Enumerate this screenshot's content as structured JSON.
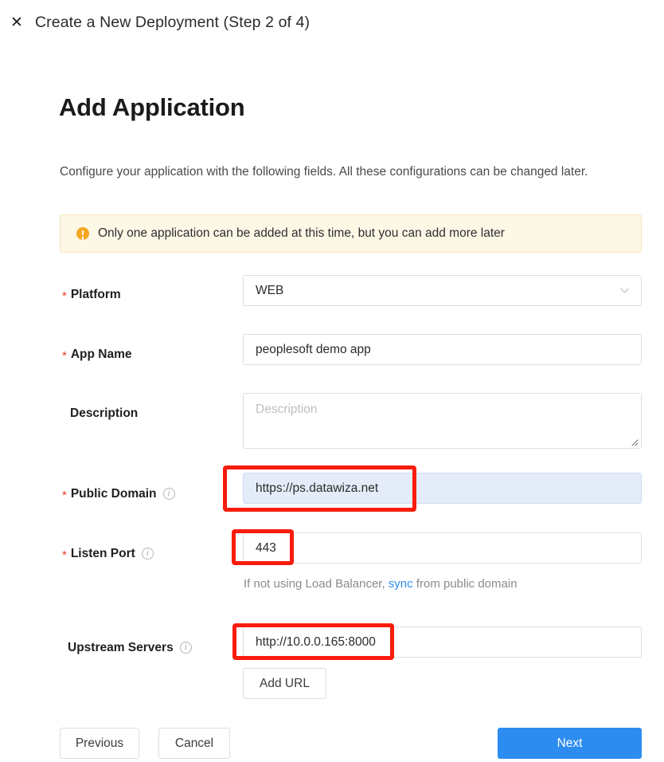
{
  "window": {
    "close_icon": "close-x-icon",
    "title": "Create a New Deployment (Step 2 of 4)"
  },
  "page": {
    "title": "Add Application",
    "subtitle": "Configure your application with the following fields. All these configurations can be changed later."
  },
  "alert": {
    "icon": "warning-circle-icon",
    "text": "Only one application can be added at this time, but you can add more later",
    "background_color": "#fdf7e6",
    "border_color": "#f5e6b8",
    "icon_color": "#f5a623"
  },
  "form": {
    "required_marker": "*",
    "info_icon_glyph": "i",
    "fields": [
      {
        "label": "Platform",
        "required": true,
        "has_info": false,
        "type": "select",
        "value": "WEB",
        "caret_icon": "chevron-down-icon"
      },
      {
        "label": "App Name",
        "required": true,
        "has_info": false,
        "type": "text",
        "value": "peoplesoft demo app"
      },
      {
        "label": "Description",
        "required": false,
        "has_info": false,
        "type": "textarea",
        "value": "",
        "placeholder": "Description"
      },
      {
        "label": "Public Domain",
        "required": true,
        "has_info": true,
        "type": "text",
        "value": "https://ps.datawiza.net",
        "highlighted": true
      },
      {
        "label": "Listen Port",
        "required": true,
        "has_info": true,
        "type": "text",
        "value": "443"
      },
      {
        "label": "Upstream Servers",
        "required": false,
        "has_info": true,
        "type": "text",
        "value": "http://10.0.0.165:8000"
      }
    ],
    "listen_port_help": {
      "prefix": "If not using Load Balancer, ",
      "link": "sync",
      "suffix": " from public domain",
      "link_color": "#2d8cf0"
    },
    "add_url_button": "Add URL"
  },
  "footer": {
    "previous": "Previous",
    "cancel": "Cancel",
    "next": "Next",
    "next_color": "#2d8cf0"
  },
  "annotations": {
    "color": "#f91c0d",
    "boxes": [
      "public-domain-highlight",
      "listen-port-highlight",
      "upstream-servers-highlight"
    ]
  }
}
